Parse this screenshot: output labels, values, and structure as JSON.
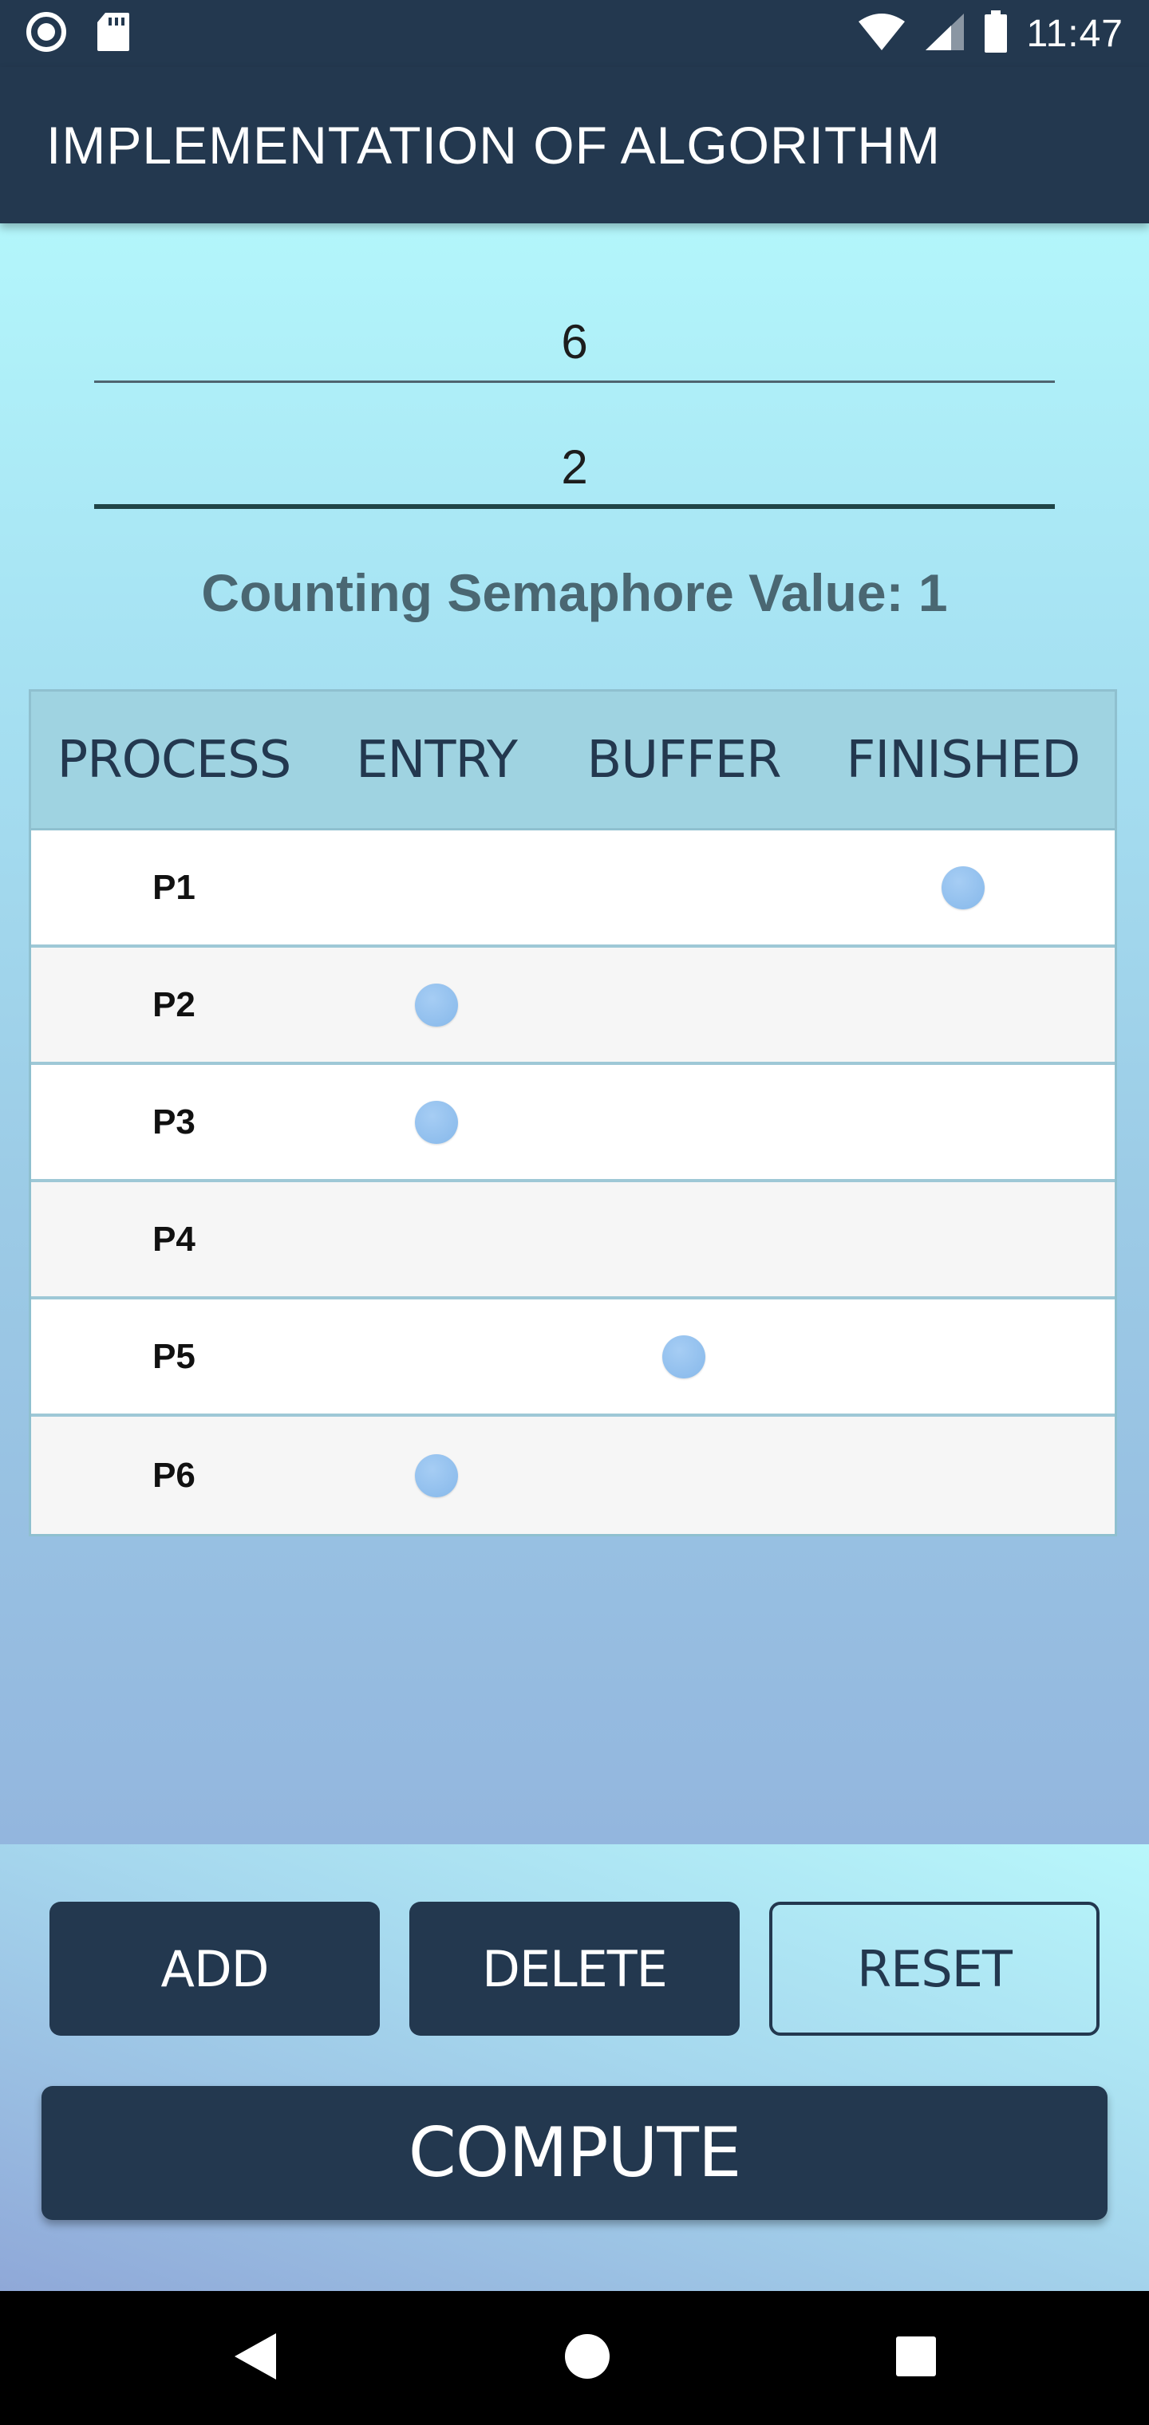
{
  "status_bar": {
    "time": "11:47",
    "left_icons": [
      "record-icon",
      "sd-card-icon"
    ],
    "right_icons": [
      "wifi-icon",
      "signal-icon",
      "battery-icon"
    ]
  },
  "app_bar": {
    "title": "IMPLEMENTATION OF ALGORITHM"
  },
  "inputs": {
    "first_value": "6",
    "second_value": "2"
  },
  "semaphore": {
    "text": "Counting Semaphore Value: 1"
  },
  "table": {
    "headers": [
      "PROCESS",
      "ENTRY",
      "BUFFER",
      "FINISHED"
    ],
    "rows": [
      {
        "label": "P1",
        "state": "FINISHED"
      },
      {
        "label": "P2",
        "state": "ENTRY"
      },
      {
        "label": "P3",
        "state": "ENTRY"
      },
      {
        "label": "P4",
        "state": ""
      },
      {
        "label": "P5",
        "state": "BUFFER"
      },
      {
        "label": "P6",
        "state": "ENTRY"
      }
    ]
  },
  "buttons": {
    "add": "ADD",
    "delete": "DELETE",
    "reset": "RESET",
    "compute": "COMPUTE"
  },
  "nav_bar": {
    "icons": [
      "back-icon",
      "home-icon",
      "recents-icon"
    ]
  },
  "colors": {
    "primary": "#23384f",
    "indicator": "#8dbcec",
    "table_header": "#9fd3e1"
  }
}
